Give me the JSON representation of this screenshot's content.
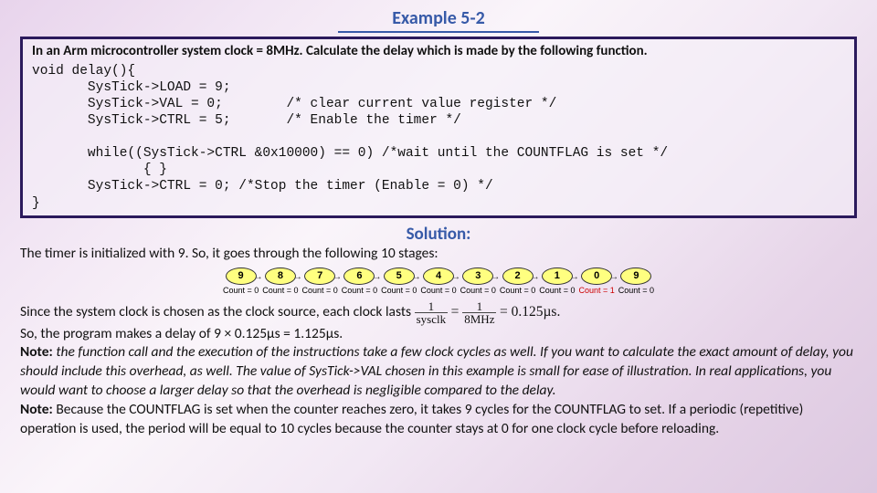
{
  "title": "Example 5-2",
  "question": "In an Arm microcontroller system clock = 8MHz. Calculate the delay which is made by the following function.",
  "code": "void delay(){\n       SysTick->LOAD = 9;\n       SysTick->VAL = 0;        /* clear current value register */\n       SysTick->CTRL = 5;       /* Enable the timer */\n\n       while((SysTick->CTRL &0x10000) == 0) /*wait until the COUNTFLAG is set */\n              { }\n       SysTick->CTRL = 0; /*Stop the timer (Enable = 0) */\n}",
  "solution_label": "Solution:",
  "intro": "The timer is initialized with 9. So, it goes through the following 10 stages:",
  "stages": [
    {
      "v": "9",
      "c": "Count = 0"
    },
    {
      "v": "8",
      "c": "Count = 0"
    },
    {
      "v": "7",
      "c": "Count = 0"
    },
    {
      "v": "6",
      "c": "Count = 0"
    },
    {
      "v": "5",
      "c": "Count = 0"
    },
    {
      "v": "4",
      "c": "Count = 0"
    },
    {
      "v": "3",
      "c": "Count = 0"
    },
    {
      "v": "2",
      "c": "Count = 0"
    },
    {
      "v": "1",
      "c": "Count = 0"
    },
    {
      "v": "0",
      "c": "Count = 1",
      "red": true
    },
    {
      "v": "9",
      "c": "Count = 0"
    }
  ],
  "line_clock_pre": "Since the system clock is chosen as the clock source, each clock lasts ",
  "frac1_num": "1",
  "frac1_den": "sysclk",
  "eq": " = ",
  "frac2_num": "1",
  "frac2_den": "8MHz",
  "line_clock_post": " = 0.125µs.",
  "line_delay": "So, the program makes a delay of 9 × 0.125µs = 1.125µs.",
  "note1_label": "Note: ",
  "note1_body": "the function call and the execution of the instructions take a few clock cycles as well. If you want to calculate the exact amount of delay, you should include this overhead, as well. The value of SysTick->VAL chosen in this example is small for ease of illustration. In real applications, you would want to choose a larger delay so that the overhead is negligible compared to the delay.",
  "note2_label": "Note: ",
  "note2_body": "Because the COUNTFLAG is set when the counter reaches zero, it takes 9 cycles for the COUNTFLAG to set. If a periodic (repetitive) operation is used, the period will be equal to 10 cycles because the counter stays at 0 for one clock cycle before reloading."
}
